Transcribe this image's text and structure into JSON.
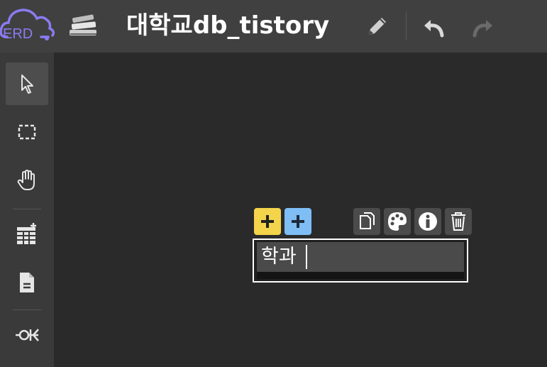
{
  "app": {
    "logo_text": "ERD",
    "title": "대학교db_tistory",
    "accent_color": "#8a7bf0"
  },
  "topbar": {
    "icons": [
      "database-stack-icon",
      "pencil-icon",
      "undo-icon",
      "redo-icon"
    ]
  },
  "sidebar": {
    "tools": [
      "pointer-icon",
      "select-box-icon",
      "hand-icon",
      "add-table-icon",
      "add-memo-icon",
      "relationship-icon"
    ],
    "active_tool": "pointer-icon"
  },
  "table": {
    "name": "학과",
    "toolbar": [
      "add-column-button",
      "add-primary-key-column-button",
      "copy-table-button",
      "color-palette-button",
      "info-button",
      "delete-table-button"
    ],
    "add_column_color": "#f3d44b",
    "add_pk_color": "#7fbdf5"
  }
}
